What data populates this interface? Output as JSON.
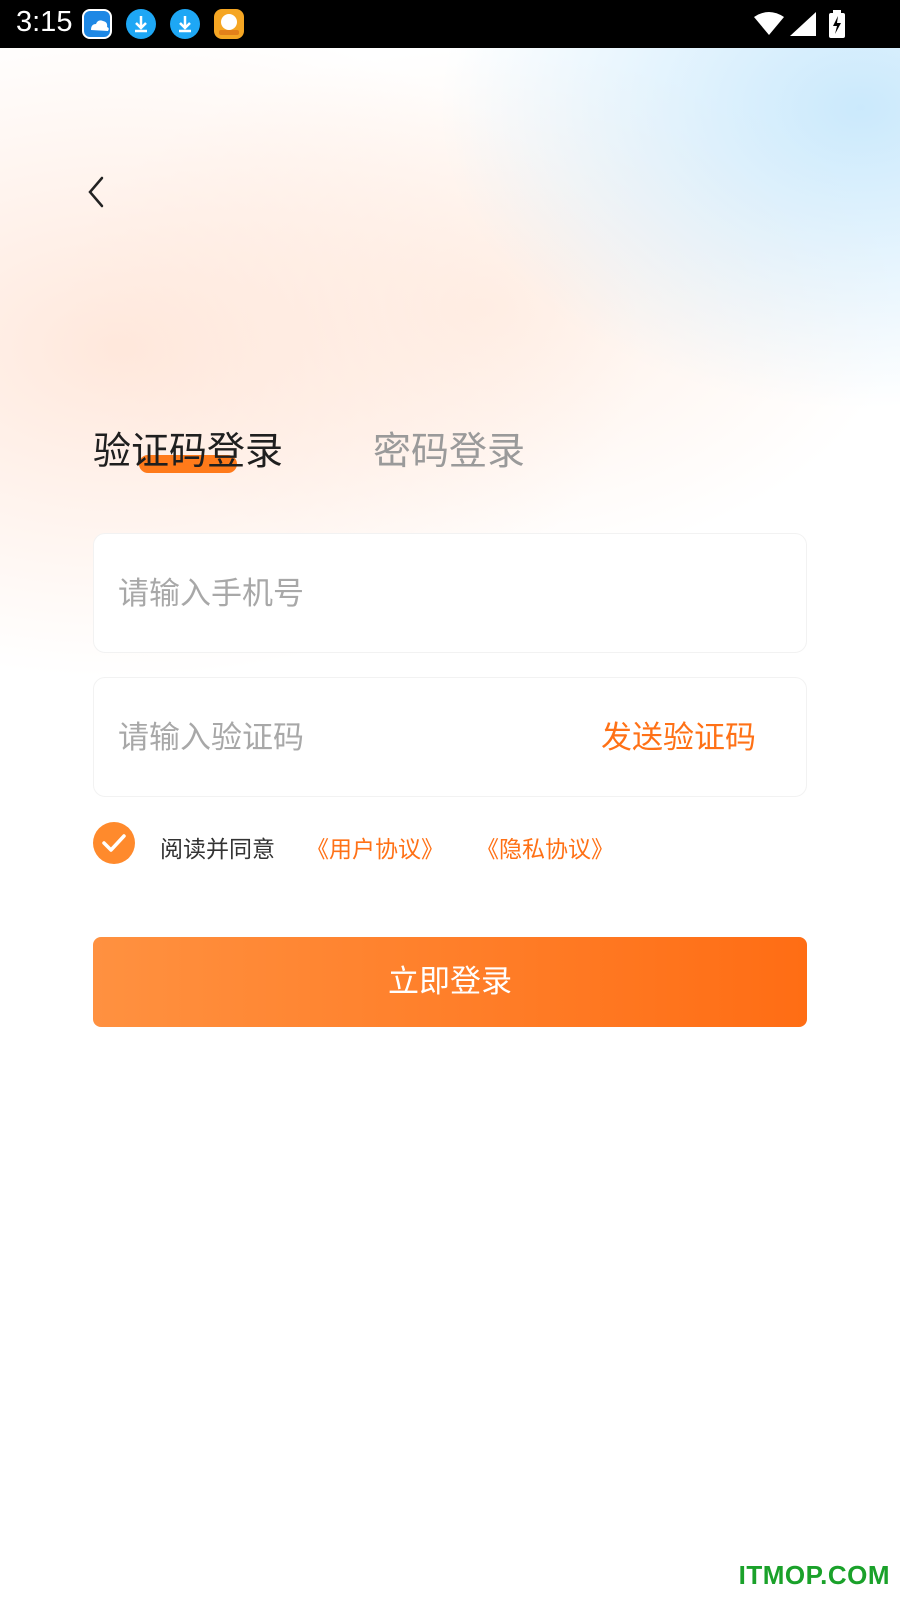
{
  "status_bar": {
    "time": "3:15",
    "icons": [
      "cloud-app-icon",
      "download-icon",
      "download-icon",
      "game-app-icon",
      "wifi-icon",
      "signal-icon",
      "battery-charging-icon"
    ]
  },
  "nav": {
    "back_icon": "chevron-left-icon"
  },
  "tabs": [
    {
      "label": "验证码登录",
      "active": true
    },
    {
      "label": "密码登录",
      "active": false
    }
  ],
  "form": {
    "phone_placeholder": "请输入手机号",
    "code_placeholder": "请输入验证码",
    "send_code_label": "发送验证码"
  },
  "agreement": {
    "checked": true,
    "text": "阅读并同意",
    "user_agreement": "《用户协议》",
    "privacy_agreement": "《隐私协议》"
  },
  "login_button_label": "立即登录",
  "watermark": "ITMOP.COM",
  "colors": {
    "accent": "#ff7116",
    "button_gradient_start": "#ff9140",
    "button_gradient_end": "#ff6d14",
    "watermark": "#1aa12a"
  }
}
